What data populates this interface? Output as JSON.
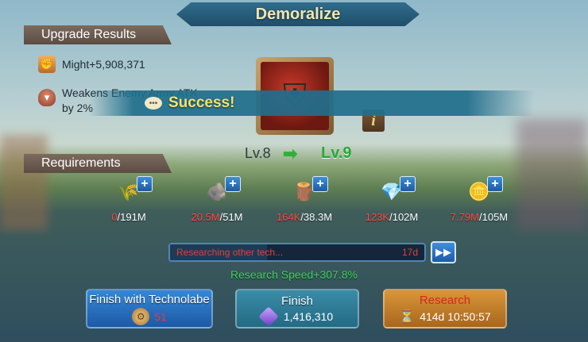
{
  "title": "Demoralize",
  "upgrade": {
    "label": "Upgrade Results",
    "might": "Might+5,908,371",
    "effect_line1": "Weakens Enemy Army ATK",
    "effect_line2": "by 2%"
  },
  "banner": {
    "text": "Success!"
  },
  "level": {
    "from": "Lv.8",
    "arrow": "➡",
    "to": "Lv.9"
  },
  "requirements": {
    "label": "Requirements",
    "items": [
      {
        "icon": "wheat-icon",
        "have": "0",
        "need": "/191M"
      },
      {
        "icon": "stone-icon",
        "have": "20.5M",
        "need": "/51M"
      },
      {
        "icon": "timber-icon",
        "have": "164K",
        "need": "/38.3M"
      },
      {
        "icon": "ore-icon",
        "have": "123K",
        "need": "/102M"
      },
      {
        "icon": "gold-icon",
        "have": "7.79M",
        "need": "/105M"
      }
    ]
  },
  "progress": {
    "text": "Researching other tech...",
    "time": "17d",
    "fill_fraction": 0.38
  },
  "speed": "Research Speed+307.8%",
  "buttons": {
    "techno": {
      "label": "Finish with Technolabe",
      "value": "51"
    },
    "finish": {
      "label": "Finish",
      "value": "1,416,310"
    },
    "research": {
      "label": "Research",
      "value": "414d 10:50:57"
    }
  },
  "colors": {
    "accent_blue": "#2f6d8c",
    "success_green": "#2ea53a",
    "deficit_red": "#ff4b3e",
    "title_gold": "#f2e6b0"
  }
}
